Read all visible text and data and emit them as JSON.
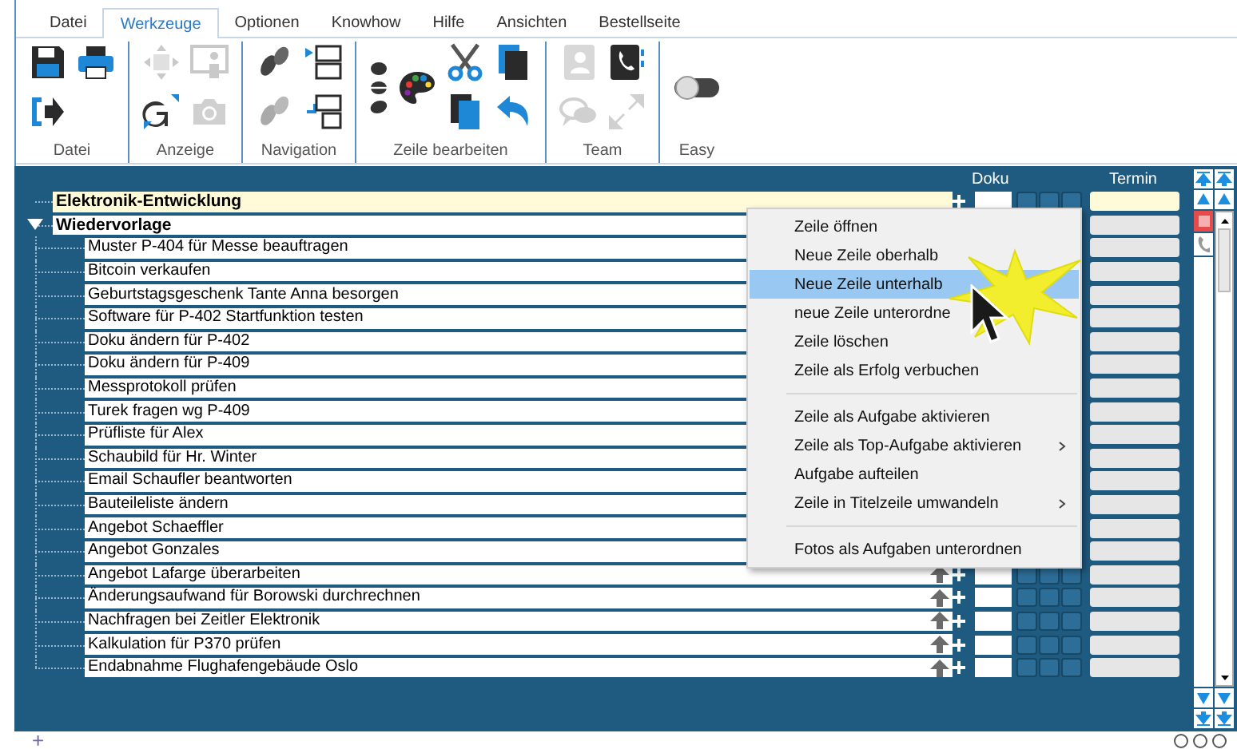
{
  "tabs": [
    {
      "label": "Datei",
      "selected": false
    },
    {
      "label": "Werkzeuge",
      "selected": true
    },
    {
      "label": "Optionen",
      "selected": false
    },
    {
      "label": "Knowhow",
      "selected": false
    },
    {
      "label": "Hilfe",
      "selected": false
    },
    {
      "label": "Ansichten",
      "selected": false
    },
    {
      "label": "Bestellseite",
      "selected": false
    }
  ],
  "ribbon": {
    "groups": [
      {
        "label": "Datei",
        "icons": [
          {
            "kind": "save",
            "disabled": false
          },
          {
            "kind": "exit",
            "disabled": false
          },
          {
            "kind": "print",
            "disabled": false
          }
        ]
      },
      {
        "label": "Anzeige",
        "icons": [
          {
            "kind": "move",
            "disabled": true
          },
          {
            "kind": "translate",
            "disabled": false
          },
          {
            "kind": "presenter",
            "disabled": true
          },
          {
            "kind": "camera",
            "disabled": true
          }
        ]
      },
      {
        "label": "Navigation",
        "icons": [
          {
            "kind": "footprints",
            "disabled": false
          },
          {
            "kind": "footprints",
            "disabled": true
          },
          {
            "kind": "rows-arrow",
            "disabled": false
          },
          {
            "kind": "rows-indent",
            "disabled": false
          }
        ]
      },
      {
        "label": "Zeile bearbeiten",
        "icons": [
          {
            "kind": "text-style",
            "disabled": false
          },
          {
            "kind": "palette",
            "disabled": false
          },
          {
            "kind": "scissors",
            "disabled": false
          },
          {
            "kind": "copy",
            "disabled": false
          },
          {
            "kind": "clipboard",
            "disabled": false
          },
          {
            "kind": "undo",
            "disabled": false
          }
        ]
      },
      {
        "label": "Team",
        "icons": [
          {
            "kind": "contacts",
            "disabled": true
          },
          {
            "kind": "chat",
            "disabled": true
          },
          {
            "kind": "phone",
            "disabled": false
          },
          {
            "kind": "expand",
            "disabled": true
          }
        ]
      },
      {
        "label": "Easy",
        "icons": [
          {
            "kind": "toggle",
            "disabled": false
          }
        ]
      }
    ]
  },
  "table": {
    "columns": [
      "Doku",
      "Termin"
    ],
    "groups": [
      {
        "label": "Elektronik-Entwicklung",
        "selected": true,
        "expanded": false
      },
      {
        "label": "Wiedervorlage",
        "selected": false,
        "expanded": true,
        "children": [
          {
            "label": "Muster P-404 für Messe beauftragen"
          },
          {
            "label": "Bitcoin verkaufen"
          },
          {
            "label": "Geburtstagsgeschenk Tante Anna besorgen"
          },
          {
            "label": "Software für P-402 Startfunktion testen"
          },
          {
            "label": "Doku ändern für P-402"
          },
          {
            "label": "Doku ändern für P-409"
          },
          {
            "label": "Messprotokoll prüfen"
          },
          {
            "label": "Turek fragen wg P-409"
          },
          {
            "label": "Prüfliste für Alex"
          },
          {
            "label": "Schaubild für Hr. Winter"
          },
          {
            "label": "Email Schaufler beantworten"
          },
          {
            "label": "Bauteileliste ändern"
          },
          {
            "label": "Angebot Schaeffler"
          },
          {
            "label": "Angebot Gonzales"
          },
          {
            "label": "Angebot Lafarge überarbeiten"
          },
          {
            "label": "Änderungsaufwand für Borowski durchrechnen"
          },
          {
            "label": "Nachfragen bei Zeitler Elektronik"
          },
          {
            "label": "Kalkulation für P370 prüfen"
          },
          {
            "label": "Endabnahme Flughafengebäude Oslo"
          }
        ]
      }
    ]
  },
  "context_menu": {
    "items": [
      {
        "kind": "item",
        "label": "Zeile öffnen",
        "selected": false,
        "submenu": false
      },
      {
        "kind": "item",
        "label": "Neue Zeile oberhalb",
        "selected": false,
        "submenu": false
      },
      {
        "kind": "item",
        "label": "Neue Zeile unterhalb",
        "selected": true,
        "submenu": false
      },
      {
        "kind": "item",
        "label": "neue Zeile unterordne",
        "selected": false,
        "submenu": false
      },
      {
        "kind": "item",
        "label": "Zeile löschen",
        "selected": false,
        "submenu": false
      },
      {
        "kind": "item",
        "label": "Zeile als Erfolg verbuchen",
        "selected": false,
        "submenu": false
      },
      {
        "kind": "separator"
      },
      {
        "kind": "item",
        "label": "Zeile als Aufgabe aktivieren",
        "selected": false,
        "submenu": false
      },
      {
        "kind": "item",
        "label": "Zeile als Top-Aufgabe aktivieren",
        "selected": false,
        "submenu": true
      },
      {
        "kind": "item",
        "label": "Aufgabe aufteilen",
        "selected": false,
        "submenu": false
      },
      {
        "kind": "item",
        "label": "Zeile in Titelzeile umwandeln",
        "selected": false,
        "submenu": true
      },
      {
        "kind": "separator"
      },
      {
        "kind": "item",
        "label": "Fotos als Aufgaben unterordnen",
        "selected": false,
        "submenu": false
      }
    ]
  },
  "status_bar": {
    "add_button": "+"
  }
}
